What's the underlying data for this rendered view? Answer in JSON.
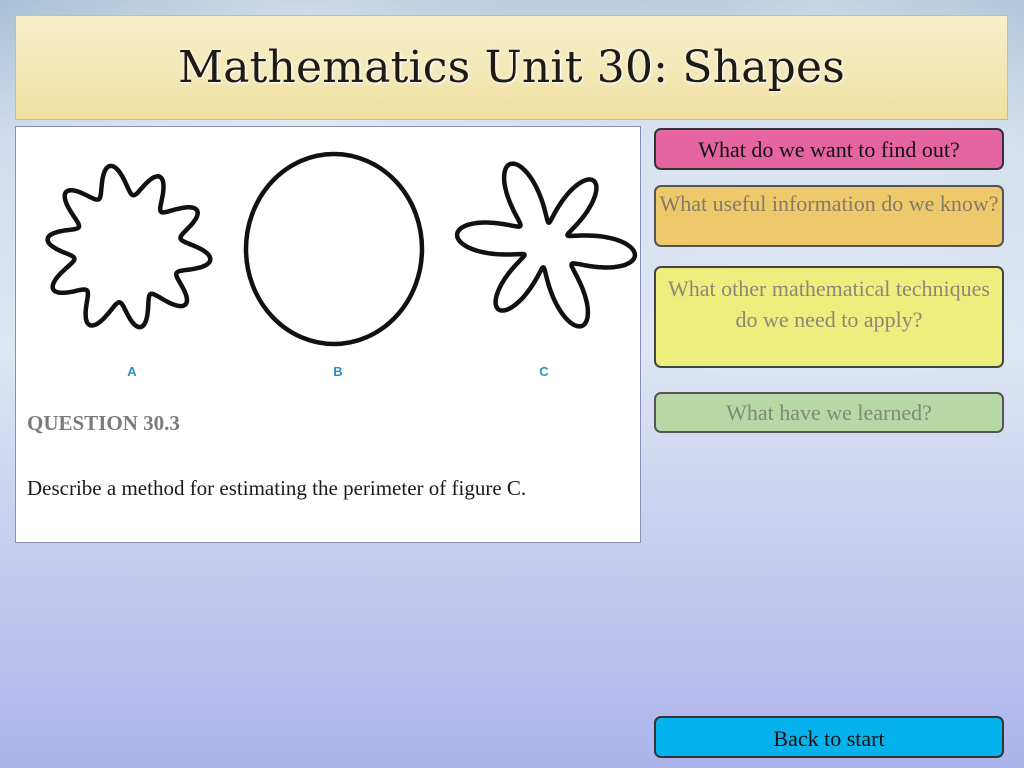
{
  "title": "Mathematics Unit 30: Shapes",
  "figures": {
    "labels": [
      "A",
      "B",
      "C"
    ]
  },
  "question": {
    "heading": "QUESTION 30.3",
    "body": "Describe a method for estimating the perimeter of figure C."
  },
  "buttons": {
    "find_out": "What do we want to find out?",
    "useful_info": "What useful information do we know?",
    "techniques": "What other mathematical techniques do we need to apply?",
    "learned": "What have we learned?",
    "back": "Back to start"
  },
  "colors": {
    "find_out": "#e565a0",
    "useful_info": "#edc96b",
    "techniques": "#eeee7e",
    "learned": "#b7d8a4",
    "back": "#05b2ec",
    "title_bg": "#f3e8b7"
  }
}
